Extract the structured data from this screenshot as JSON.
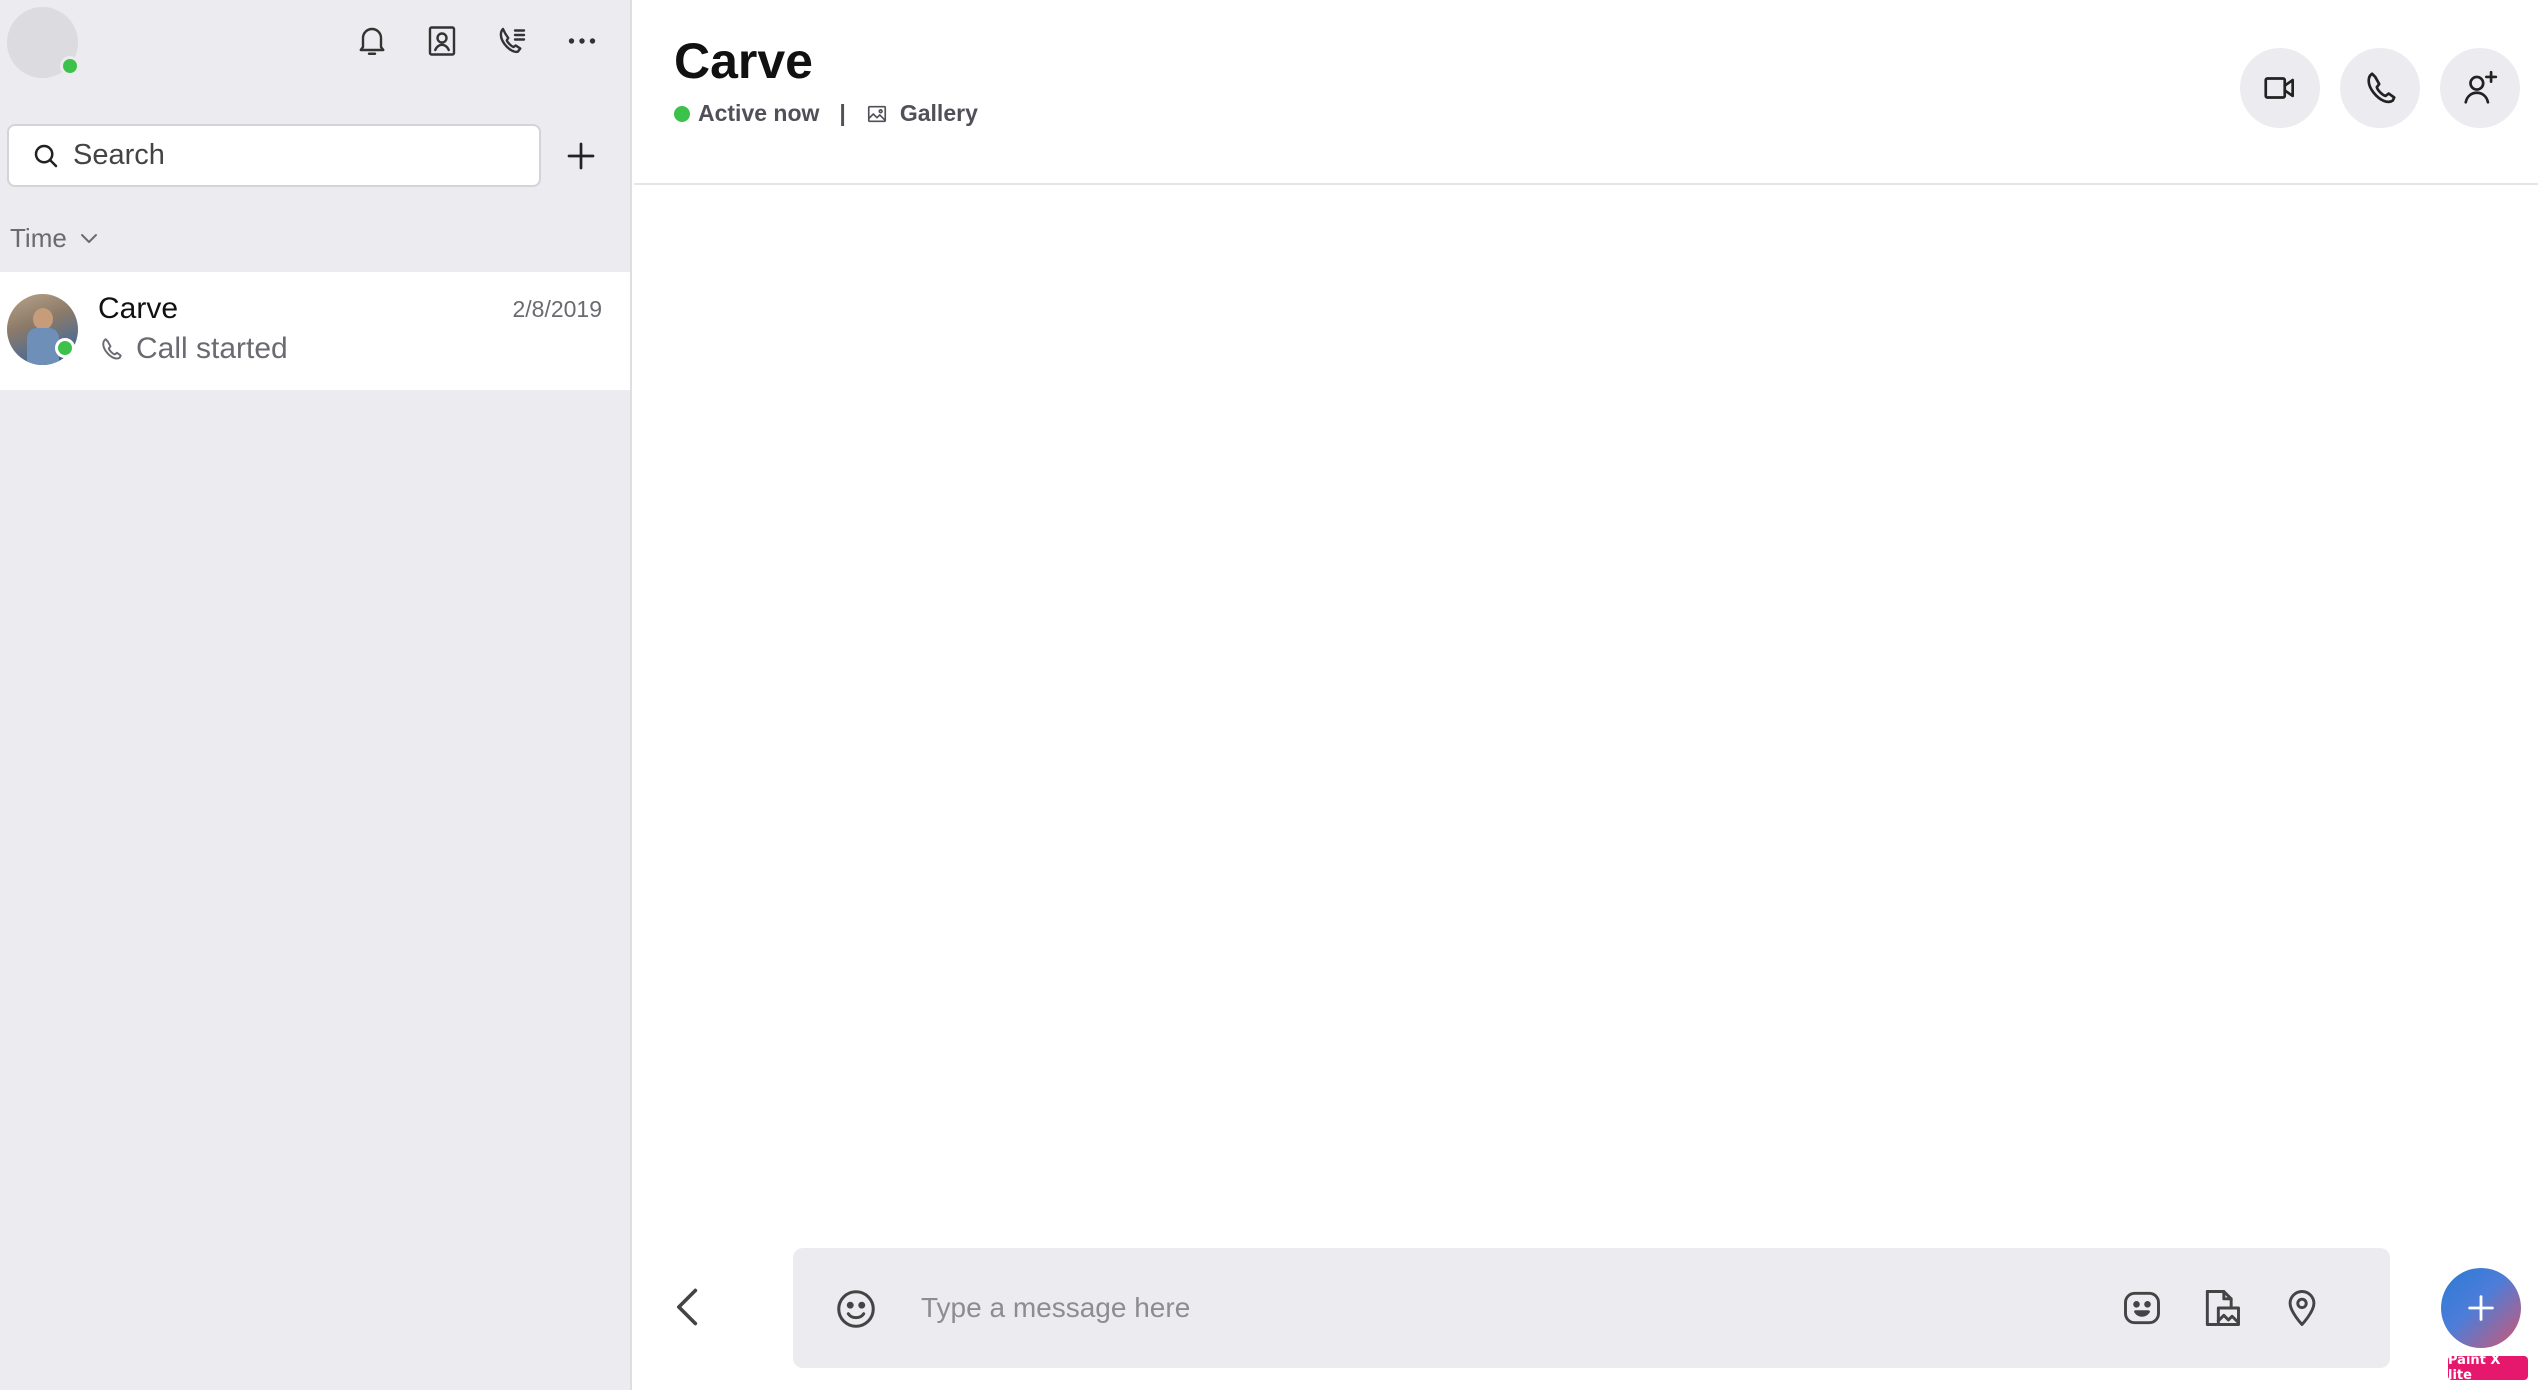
{
  "sidebar": {
    "search": {
      "placeholder": "Search",
      "value": ""
    },
    "sort": {
      "label": "Time"
    },
    "conversations": [
      {
        "name": "Carve",
        "date": "2/8/2019",
        "preview": "Call started",
        "online": true
      }
    ]
  },
  "chat": {
    "title": "Carve",
    "status": "Active now",
    "separator": "|",
    "gallery_label": "Gallery"
  },
  "composer": {
    "placeholder": "Type a message here",
    "value": ""
  },
  "watermark": "Paint X lite",
  "colors": {
    "online": "#3cc24a",
    "sidebar_bg": "#ecebef",
    "fab_gradient_start": "#2a7ad6",
    "fab_gradient_end": "#d0566f",
    "watermark_bg": "#e6186e"
  },
  "icons": {
    "top_bar": [
      "bell-icon",
      "contacts-icon",
      "call-log-icon",
      "more-icon"
    ],
    "header": [
      "video-call-icon",
      "audio-call-icon",
      "add-people-icon"
    ],
    "composer": [
      "emoji-icon",
      "sticker-icon",
      "file-image-icon",
      "location-icon"
    ]
  }
}
